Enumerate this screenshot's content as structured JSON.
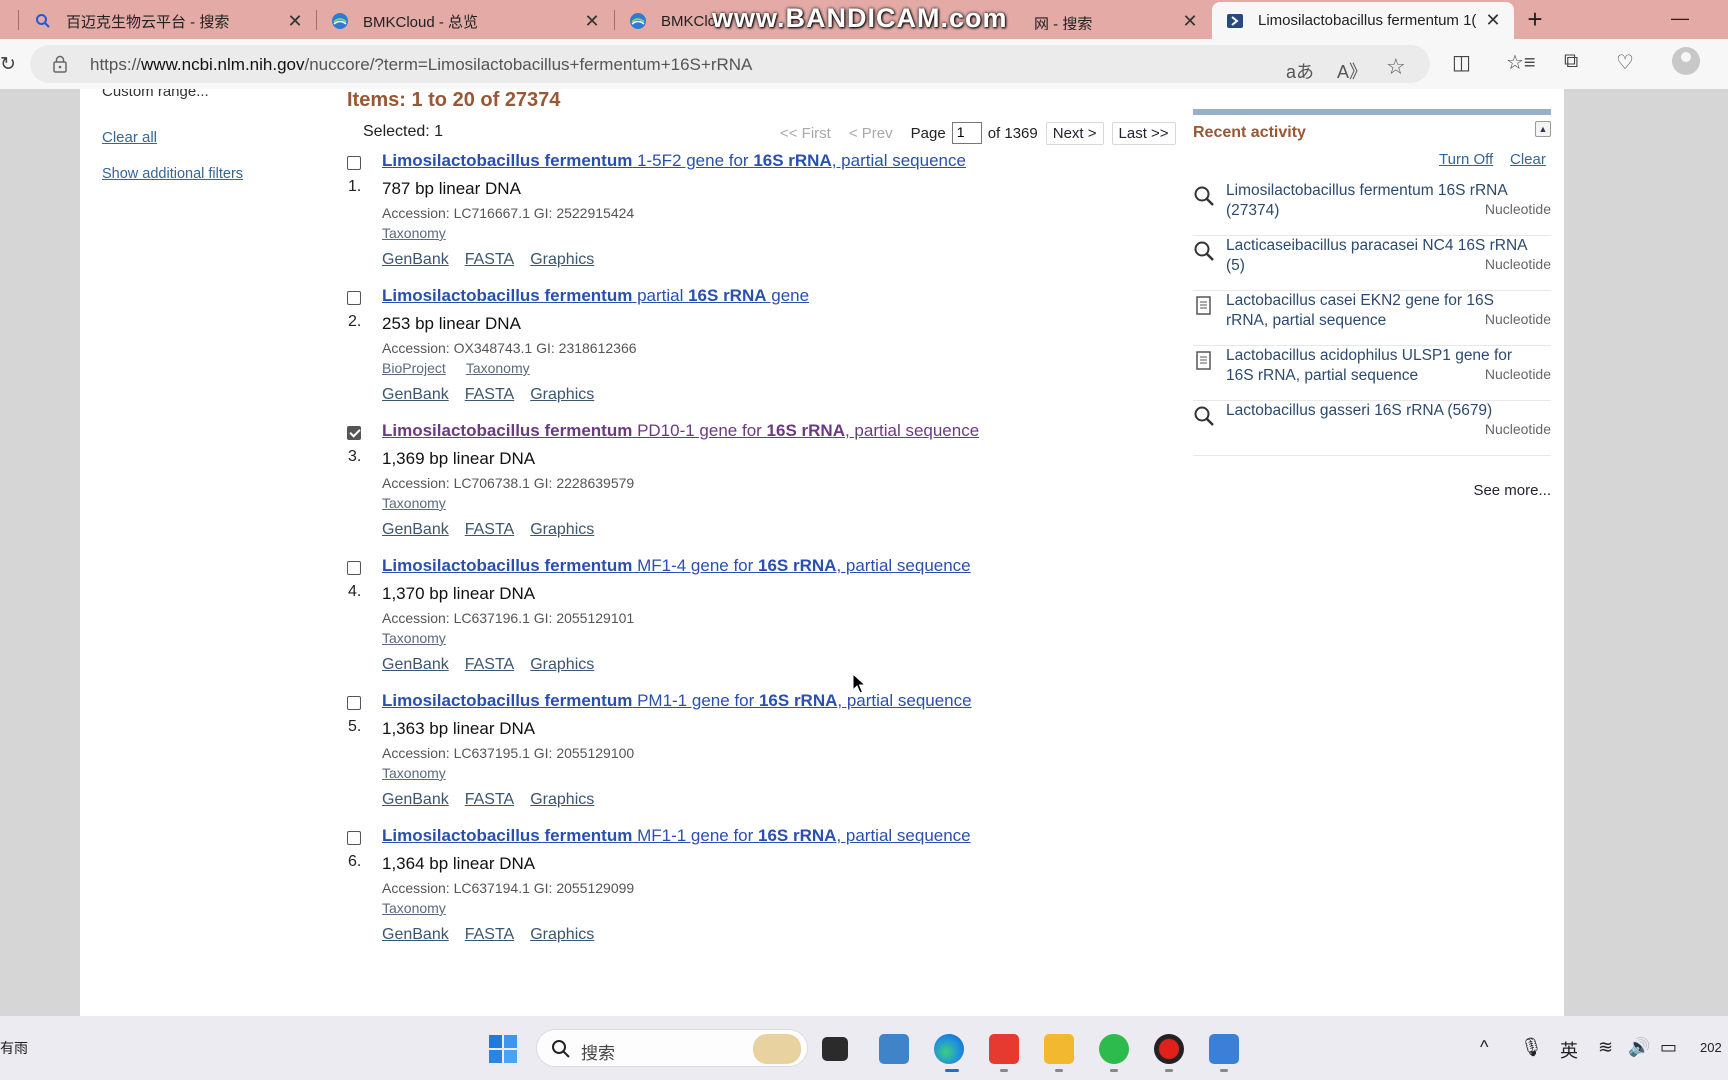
{
  "browser": {
    "tabs": [
      {
        "title": "百迈克生物云平台 - 搜索"
      },
      {
        "title": "BMKCloud - 总览"
      },
      {
        "title": "BMKClo"
      },
      {
        "title": "网 - 搜索"
      },
      {
        "title": "Limosilactobacillus fermentum 1("
      }
    ],
    "watermark": "www.BANDICAM.com",
    "url_prefix": "https://",
    "url_host": "www.ncbi.nlm.nih.gov",
    "url_path": "/nuccore/?term=Limosilactobacillus+fermentum+16S+rRNA",
    "icons": {
      "translate": "aあ",
      "read_aloud": "A》",
      "favorite": "☆",
      "split": "◫",
      "favorites": "☆≡",
      "collections": "⧉",
      "performance": "♡"
    }
  },
  "sidebar": {
    "custom_range": "Custom range...",
    "clear_all": "Clear all",
    "show_filters": "Show additional filters"
  },
  "results_header": {
    "items": "Items: 1 to 20 of 27374",
    "selected": "Selected: 1"
  },
  "pager": {
    "first": "<< First",
    "prev": "< Prev",
    "page_label": "Page",
    "page_value": "1",
    "of_label": "of 1369",
    "next": "Next >",
    "last": "Last >>"
  },
  "results": [
    {
      "num": "1.",
      "checked": false,
      "title_parts": [
        "Limosilactobacillus fermentum",
        " 1-5F2 gene for ",
        "16S rRNA",
        ", partial sequence"
      ],
      "desc": "787 bp linear DNA",
      "accession": "Accession: LC716667.1   GI: 2522915424",
      "links": [
        "Taxonomy"
      ],
      "formats": [
        "GenBank",
        "FASTA",
        "Graphics"
      ]
    },
    {
      "num": "2.",
      "checked": false,
      "title_parts": [
        "Limosilactobacillus fermentum",
        " partial ",
        "16S rRNA",
        " gene"
      ],
      "desc": "253 bp linear DNA",
      "accession": "Accession: OX348743.1   GI: 2318612366",
      "links": [
        "BioProject",
        "Taxonomy"
      ],
      "formats": [
        "GenBank",
        "FASTA",
        "Graphics"
      ]
    },
    {
      "num": "3.",
      "checked": true,
      "title_parts": [
        "Limosilactobacillus fermentum",
        " PD10-1 gene for ",
        "16S rRNA",
        ", partial sequence"
      ],
      "desc": "1,369 bp linear DNA",
      "accession": "Accession: LC706738.1   GI: 2228639579",
      "links": [
        "Taxonomy"
      ],
      "formats": [
        "GenBank",
        "FASTA",
        "Graphics"
      ]
    },
    {
      "num": "4.",
      "checked": false,
      "title_parts": [
        "Limosilactobacillus fermentum",
        " MF1-4 gene for ",
        "16S rRNA",
        ", partial sequence"
      ],
      "desc": "1,370 bp linear DNA",
      "accession": "Accession: LC637196.1   GI: 2055129101",
      "links": [
        "Taxonomy"
      ],
      "formats": [
        "GenBank",
        "FASTA",
        "Graphics"
      ]
    },
    {
      "num": "5.",
      "checked": false,
      "title_parts": [
        "Limosilactobacillus fermentum",
        " PM1-1 gene for ",
        "16S rRNA",
        ", partial sequence"
      ],
      "desc": "1,363 bp linear DNA",
      "accession": "Accession: LC637195.1   GI: 2055129100",
      "links": [
        "Taxonomy"
      ],
      "formats": [
        "GenBank",
        "FASTA",
        "Graphics"
      ]
    },
    {
      "num": "6.",
      "checked": false,
      "title_parts": [
        "Limosilactobacillus fermentum",
        " MF1-1 gene for ",
        "16S rRNA",
        ", partial sequence"
      ],
      "desc": "1,364 bp linear DNA",
      "accession": "Accession: LC637194.1   GI: 2055129099",
      "links": [
        "Taxonomy"
      ],
      "formats": [
        "GenBank",
        "FASTA",
        "Graphics"
      ]
    }
  ],
  "recent_activity": {
    "header": "Recent activity",
    "turn_off": "Turn Off",
    "clear": "Clear",
    "see_more": "See more...",
    "items": [
      {
        "icon": "search",
        "label": "Limosilactobacillus fermentum 16S rRNA (27374)",
        "db": "Nucleotide"
      },
      {
        "icon": "search",
        "label": "Lacticaseibacillus paracasei NC4 16S rRNA (5)",
        "db": "Nucleotide"
      },
      {
        "icon": "doc",
        "label": "Lactobacillus casei EKN2 gene for 16S rRNA, partial sequence",
        "db": "Nucleotide"
      },
      {
        "icon": "doc",
        "label": "Lactobacillus acidophilus ULSP1 gene for 16S rRNA, partial sequence",
        "db": "Nucleotide"
      },
      {
        "icon": "search",
        "label": "Lactobacillus gasseri 16S rRNA (5679)",
        "db": "Nucleotide"
      }
    ]
  },
  "taskbar": {
    "weather": "有雨",
    "search_placeholder": "搜索",
    "ime": "英",
    "clock": "202"
  }
}
